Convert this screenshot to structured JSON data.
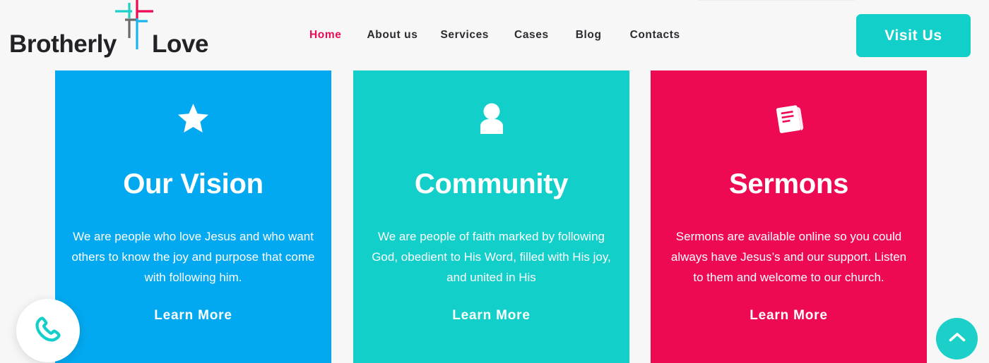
{
  "brand": {
    "name_part1": "Brotherly",
    "name_part2": "Love",
    "logo_icon": "cross-icon",
    "color_pink": "#ed0a53",
    "color_teal": "#12cfc9",
    "color_blue": "#03a9f0",
    "color_gray": "#6b6b6b"
  },
  "nav": {
    "items": [
      {
        "label": "Home",
        "active": true
      },
      {
        "label": "About us",
        "active": false
      },
      {
        "label": "Services",
        "active": false
      },
      {
        "label": "Cases",
        "active": false
      },
      {
        "label": "Blog",
        "active": false
      },
      {
        "label": "Contacts",
        "active": false
      }
    ],
    "cta_label": "Visit Us"
  },
  "cards": [
    {
      "icon": "star-icon",
      "title": "Our Vision",
      "description": "We are people who love Jesus and who want others to know the joy and purpose that come with following him.",
      "link_label": "Learn More",
      "background": "#03a9f0"
    },
    {
      "icon": "person-icon",
      "title": "Community",
      "description": "We are people of faith marked by following God, obedient to His Word, filled with His joy, and united in His",
      "link_label": "Learn More",
      "background": "#12cfc9"
    },
    {
      "icon": "book-icon",
      "title": "Sermons",
      "description": "Sermons are available online so you could always have Jesus’s and our support. Listen to them and welcome to our church.",
      "link_label": "Learn More",
      "background": "#ed0a53"
    }
  ],
  "widgets": {
    "phone": {
      "icon": "phone-icon",
      "color": "#12cfc9"
    },
    "scroll_top": {
      "icon": "chevron-up-icon",
      "color": "#1ccfc8"
    }
  }
}
